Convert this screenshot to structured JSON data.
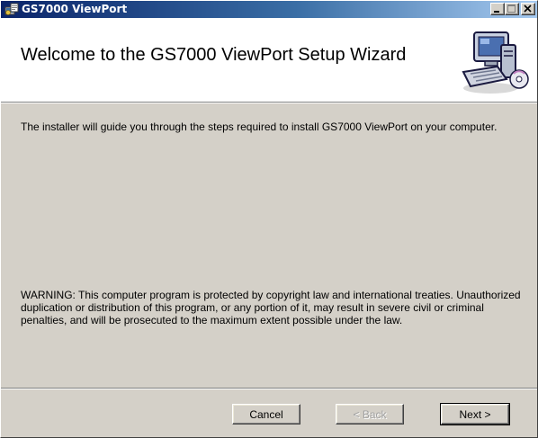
{
  "window": {
    "title": "GS7000 ViewPort"
  },
  "header": {
    "title": "Welcome to the GS7000 ViewPort Setup Wizard"
  },
  "body": {
    "intro": "The installer will guide you through the steps required to install GS7000 ViewPort on your computer.",
    "warning": "WARNING: This computer program is protected by copyright law and international treaties. Unauthorized duplication or distribution of this program, or any portion of it, may result in severe civil or criminal penalties, and will be prosecuted to the maximum extent possible under the law."
  },
  "buttons": {
    "cancel": "Cancel",
    "back": "< Back",
    "next": "Next >"
  },
  "icons": {
    "title": "installer-icon",
    "header": "computer-disc-icon",
    "minimize": "minimize-icon",
    "maximize": "maximize-icon",
    "close": "close-icon"
  },
  "colors": {
    "titlebar_start": "#0a246a",
    "titlebar_end": "#a6caf0",
    "face": "#d4d0c8"
  }
}
